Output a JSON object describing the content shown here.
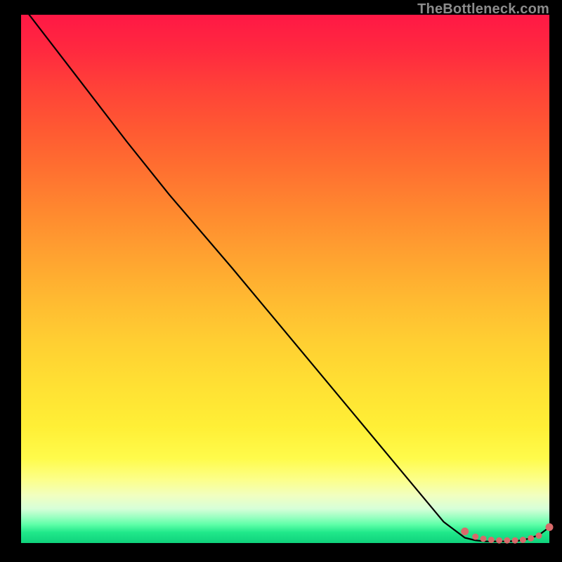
{
  "watermark": "TheBottleneck.com",
  "chart_data": {
    "type": "line",
    "title": "",
    "xlabel": "",
    "ylabel": "",
    "xlim": [
      0,
      100
    ],
    "ylim": [
      0,
      100
    ],
    "grid": false,
    "legend": false,
    "series": [
      {
        "name": "bottleneck-curve",
        "x": [
          0,
          10,
          20,
          28,
          40,
          55,
          70,
          80,
          84,
          86,
          88,
          90,
          92,
          94,
          96,
          98,
          100
        ],
        "y": [
          102,
          89,
          76,
          66,
          52,
          34,
          16,
          4,
          1,
          0.5,
          0.3,
          0.3,
          0.3,
          0.4,
          0.8,
          1.5,
          3
        ]
      }
    ],
    "markers": {
      "name": "optimal-zone-points",
      "color": "#d86a6a",
      "x": [
        84,
        86,
        87.5,
        89,
        90.5,
        92,
        93.5,
        95,
        96.5,
        98,
        100
      ],
      "y": [
        2.2,
        1.2,
        0.8,
        0.6,
        0.5,
        0.5,
        0.5,
        0.6,
        0.9,
        1.4,
        3
      ]
    }
  }
}
